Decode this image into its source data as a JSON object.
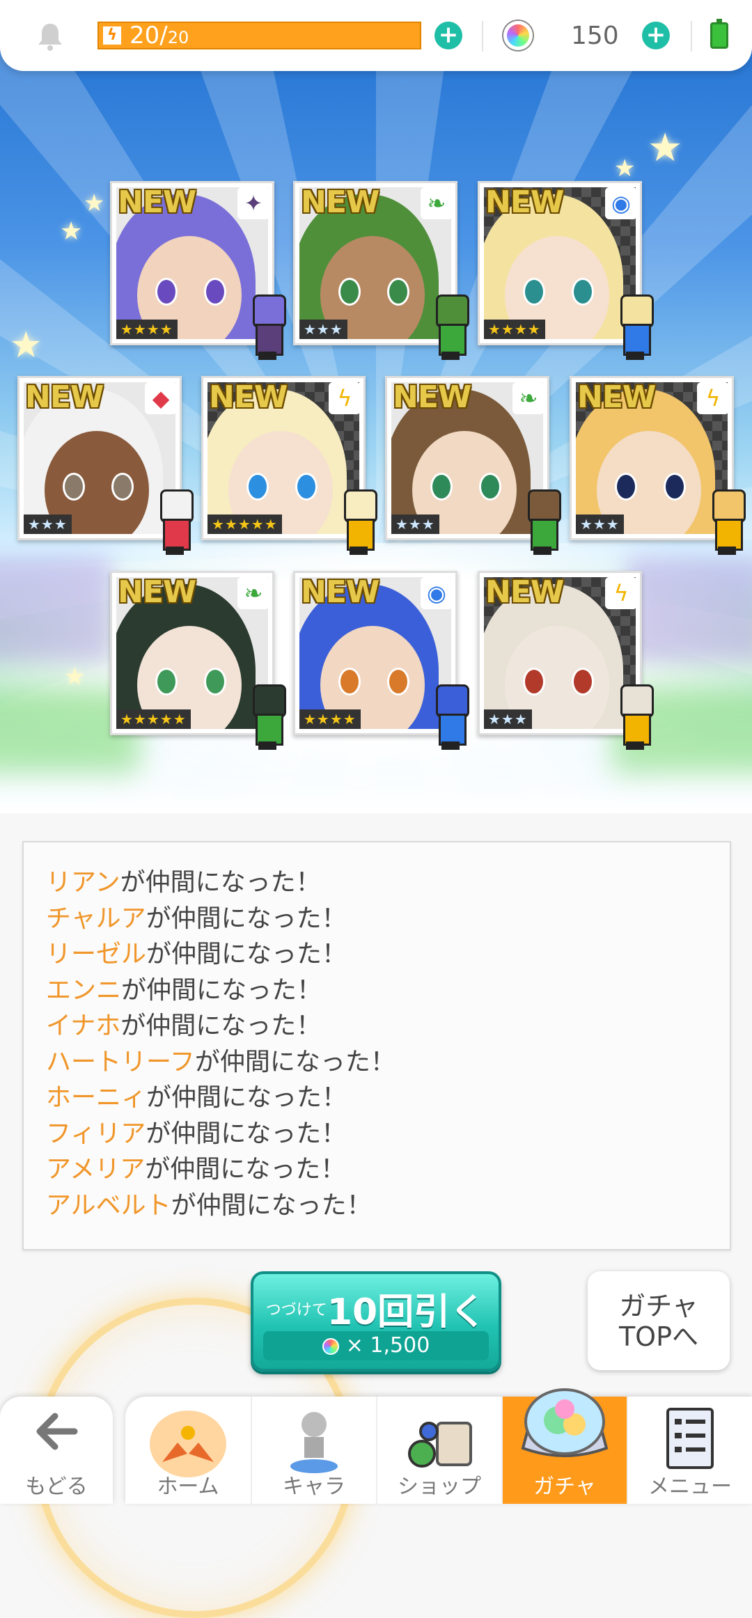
{
  "status_bar": {
    "stamina": "20/",
    "stamina_max": "20",
    "stamina_level": 1.0,
    "gems": "150",
    "accent": "#1fbea6",
    "stamina_color": "#ffa11c"
  },
  "results": {
    "new_label": "NEW",
    "cards": [
      {
        "attr_icon": "dark-icon",
        "attr_glyph": "✦",
        "attr_color": "#5a3f7a",
        "stars": "★★★★",
        "rarity": 4,
        "hair": "#7a6fd8"
      },
      {
        "attr_icon": "wind-icon",
        "attr_glyph": "❧",
        "attr_color": "#3ca83c",
        "stars": "★★★",
        "rarity": 3,
        "hair": "#4f8f3a"
      },
      {
        "attr_icon": "water-icon",
        "attr_glyph": "◉",
        "attr_color": "#2f7ae6",
        "stars": "★★★★",
        "rarity": 4,
        "hair": "#f4e3a0"
      },
      {
        "attr_icon": "fire-icon",
        "attr_glyph": "◆",
        "attr_color": "#e03a4a",
        "stars": "★★★",
        "rarity": 3,
        "hair": "#f2f2f2"
      },
      {
        "attr_icon": "lightning-icon",
        "attr_glyph": "ϟ",
        "attr_color": "#f2b400",
        "stars": "★★★★★",
        "rarity": 5,
        "hair": "#f7edc0"
      },
      {
        "attr_icon": "wind-icon",
        "attr_glyph": "❧",
        "attr_color": "#3ca83c",
        "stars": "★★★",
        "rarity": 3,
        "hair": "#7a5a3a"
      },
      {
        "attr_icon": "lightning-icon",
        "attr_glyph": "ϟ",
        "attr_color": "#f2b400",
        "stars": "★★★",
        "rarity": 3,
        "hair": "#f2c56a"
      },
      {
        "attr_icon": "wind-icon",
        "attr_glyph": "❧",
        "attr_color": "#3ca83c",
        "stars": "★★★★★",
        "rarity": 5,
        "hair": "#2b3b30"
      },
      {
        "attr_icon": "water-icon",
        "attr_glyph": "◉",
        "attr_color": "#2f7ae6",
        "stars": "★★★★",
        "rarity": 4,
        "hair": "#3b5fd8"
      },
      {
        "attr_icon": "lightning-icon",
        "attr_glyph": "ϟ",
        "attr_color": "#f2b400",
        "stars": "★★★",
        "rarity": 3,
        "hair": "#e8e2d6"
      }
    ]
  },
  "log": {
    "suffix": "が仲間になった！",
    "names": [
      "リアン",
      "チャルア",
      "リーゼル",
      "エンニ",
      "イナホ",
      "ハートリーフ",
      "ホーニィ",
      "フィリア",
      "アメリア",
      "アルベルト"
    ]
  },
  "actions": {
    "pull_prefix": "つづけて",
    "pull_main": "10回引く",
    "pull_cost": "× 1,500",
    "gacha_top_line1": "ガチャ",
    "gacha_top_line2": "TOPへ"
  },
  "nav": {
    "back": "もどる",
    "home": "ホーム",
    "chara": "キャラ",
    "shop": "ショップ",
    "gacha": "ガチャ",
    "menu": "メニュー"
  }
}
